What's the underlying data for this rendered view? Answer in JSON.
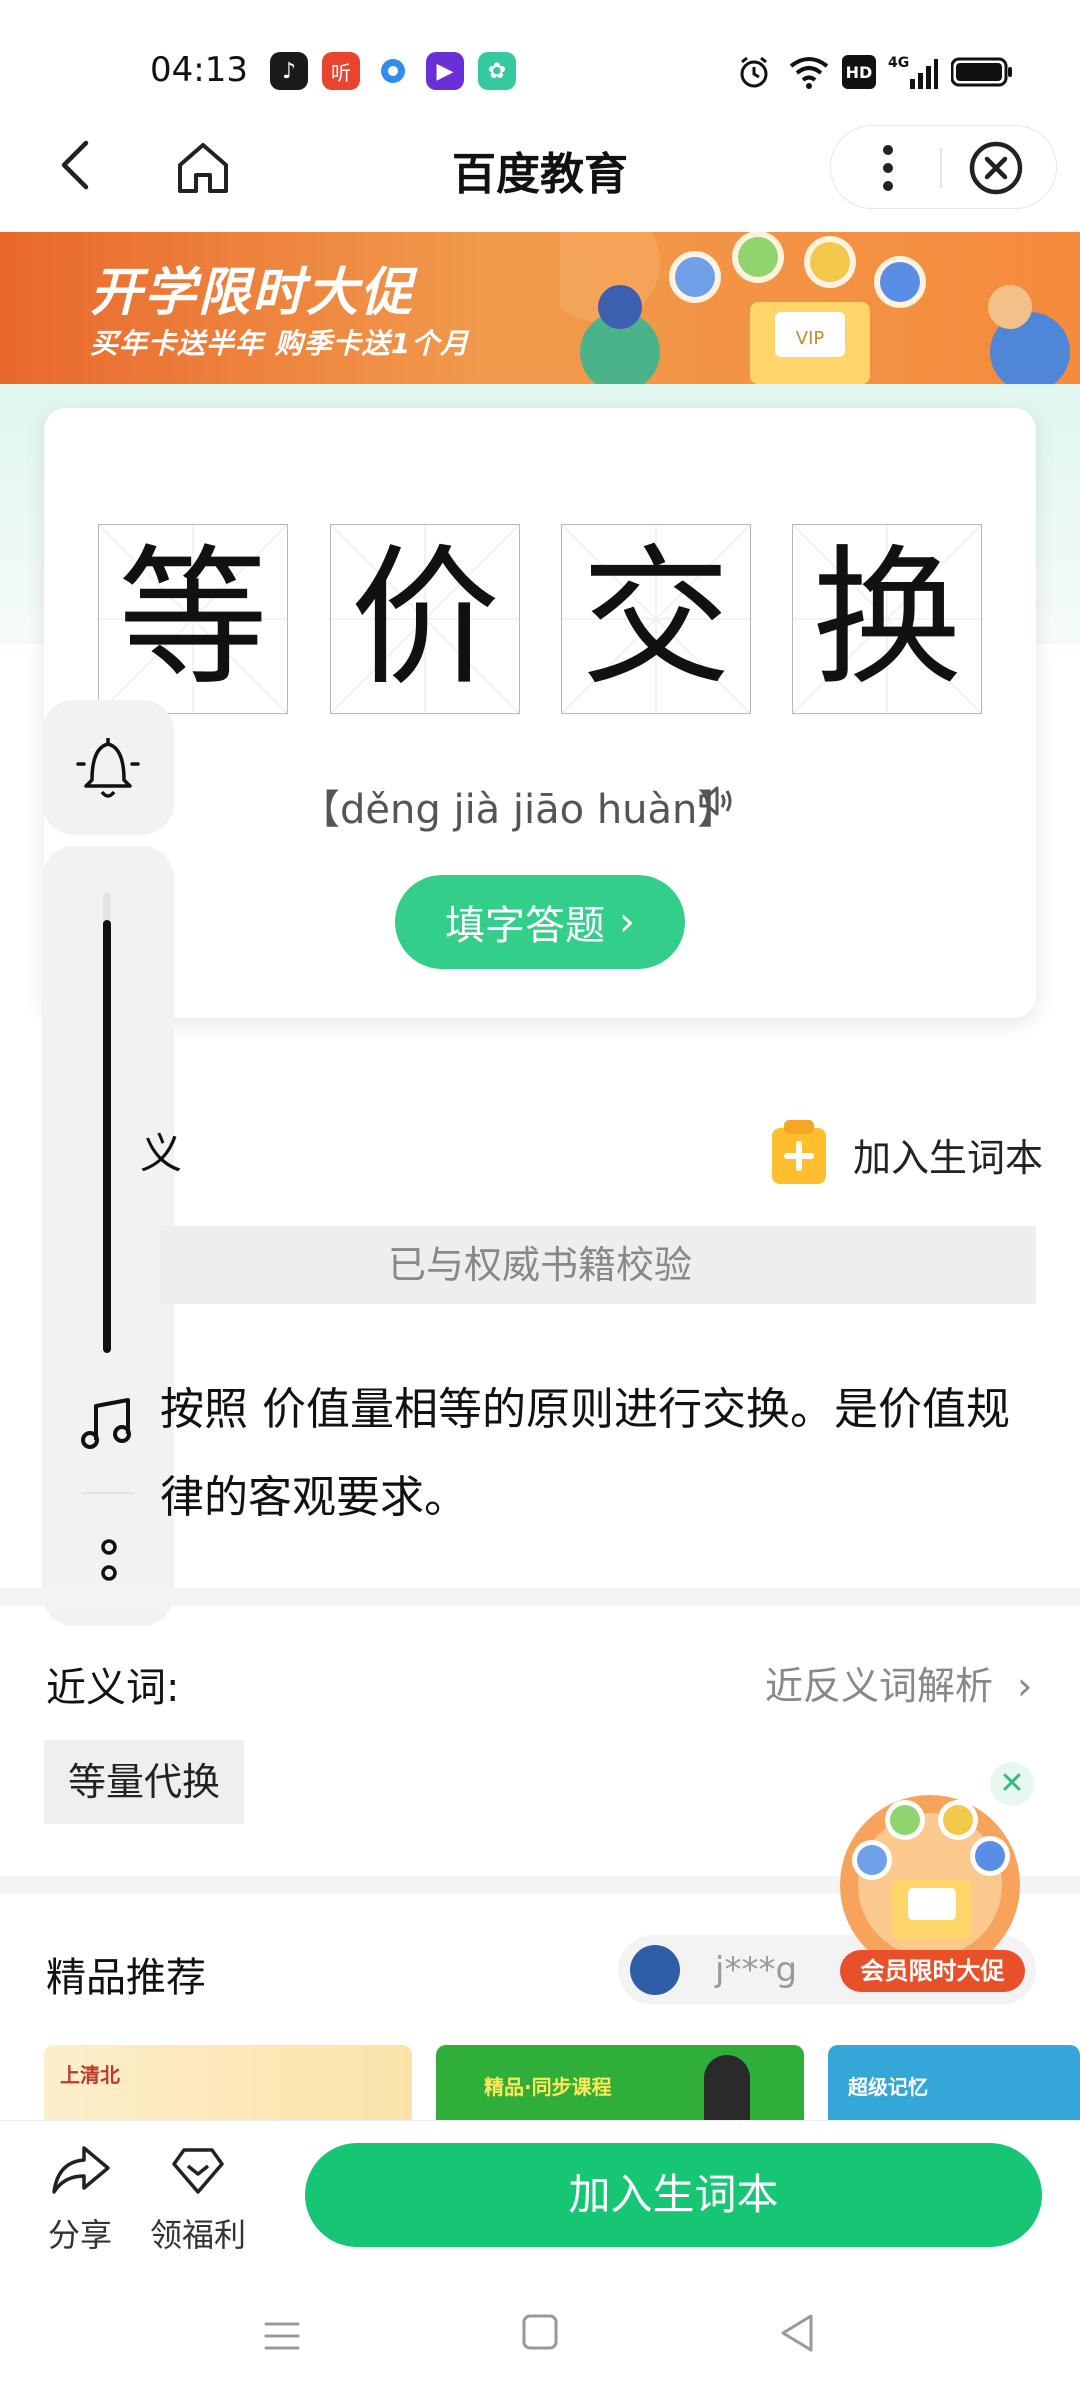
{
  "status_bar": {
    "time": "04:13",
    "app_icons": [
      "tiktok-icon",
      "ting-icon",
      "baidu-dot-icon",
      "video-icon",
      "app-green-icon"
    ],
    "system_icons": [
      "alarm-icon",
      "wifi-icon",
      "hd-icon",
      "4g-signal-icon",
      "battery-icon"
    ],
    "hd_label": "HD",
    "network_label": "4G"
  },
  "nav": {
    "title": "百度教育"
  },
  "banner": {
    "title": "开学限时大促",
    "subtitle": "买年卡送半年  购季卡送1个月"
  },
  "word": {
    "characters": [
      "等",
      "价",
      "交",
      "换"
    ],
    "pinyin": "【děng jià jiāo huàn】",
    "fill_button": "填字答题"
  },
  "meaning": {
    "title_fragment": "义",
    "add_vocab_link": "加入生词本",
    "verified": "已与权威书籍校验",
    "definition": "按照 价值量相等的原则进行交换。是价值规律的客观要求。"
  },
  "synonyms": {
    "label": "近义词:",
    "analysis_link": "近反义词解析",
    "items": [
      "等量代换"
    ]
  },
  "recommend": {
    "title": "精品推荐",
    "ticker_user": "j***g",
    "cards": [
      "上清北",
      "精品·同步课程",
      "超级记忆"
    ]
  },
  "promo": {
    "label": "会员限时大促"
  },
  "bottom_bar": {
    "share": "分享",
    "welfare": "领福利",
    "add_vocab": "加入生词本"
  },
  "colors": {
    "primary_green": "#17c675",
    "fill_button_green": "#33cf8a",
    "banner_orange": "#e9682c"
  }
}
